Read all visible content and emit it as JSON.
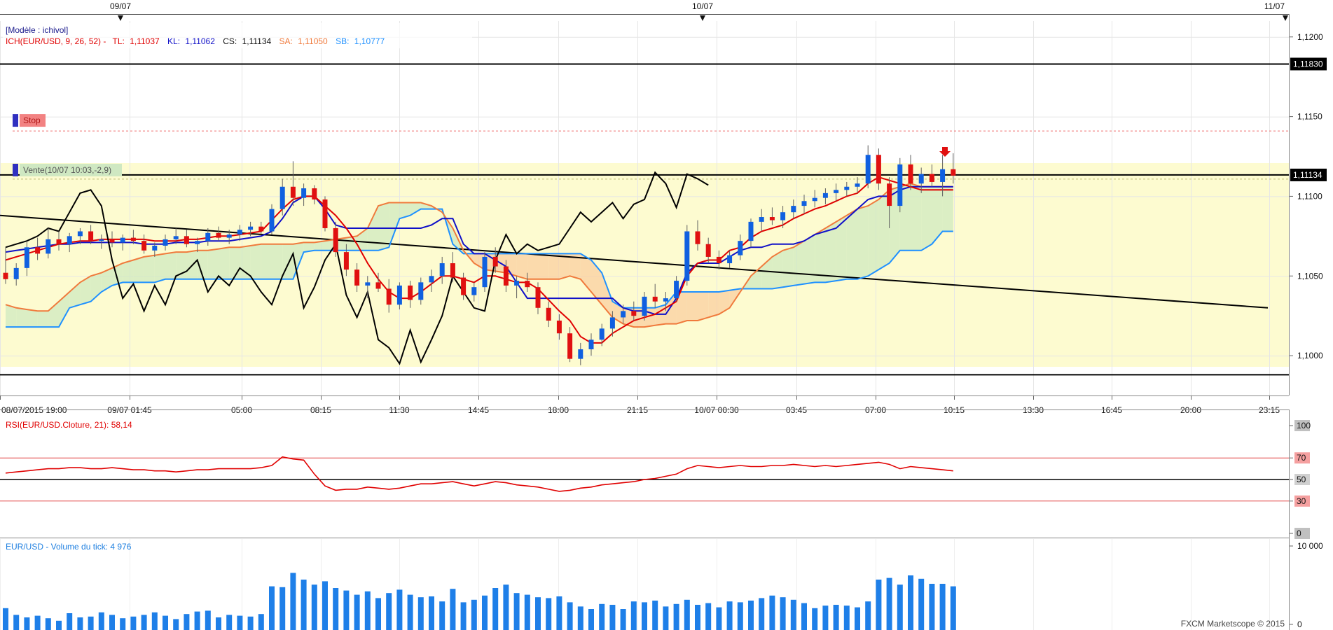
{
  "chart_data": {
    "type": "candlestick",
    "symbol": "EUR/USD",
    "model_label": "[Modèle : ichivol]",
    "date_markers": [
      "09/07",
      "10/07",
      "11/07"
    ],
    "x_tick_labels": [
      "08/07/2015 19:00",
      "09/07 01:45",
      "05:00",
      "08:15",
      "11:30",
      "14:45",
      "18:00",
      "21:15",
      "10/07 00:30",
      "03:45",
      "07:00",
      "10:15",
      "13:30",
      "16:45",
      "20:00",
      "23:15"
    ],
    "price_axis": {
      "ylim": [
        1.0975,
        1.121
      ],
      "ticks": [
        "1,1200",
        "1,1150",
        "1,1100",
        "1,1050",
        "1,1000"
      ]
    },
    "price_flags": [
      {
        "label": "1,11830",
        "value": 1.1183
      },
      {
        "label": "1,11134",
        "value": 1.11134
      }
    ],
    "horizontal_lines": [
      1.1183,
      1.11134,
      1.0988
    ],
    "trendline": {
      "from": 1.1088,
      "to": 1.103
    },
    "orders": [
      {
        "label": "Stop",
        "value": 1.1141
      },
      {
        "label": "Vente(10/07 10:03,-2,9)",
        "value": 1.11134
      }
    ],
    "ichimoku_legend": {
      "prefix": "ICH(EUR/USD, 9, 26, 52) -",
      "tl_label": "TL:",
      "tl_value": "1,11037",
      "kl_label": "KL:",
      "kl_value": "1,11062",
      "cs_label": "CS:",
      "cs_value": "1,11134",
      "sa_label": "SA:",
      "sa_value": "1,11050",
      "sb_label": "SB:",
      "sb_value": "1,10777"
    },
    "candles": [
      [
        1.1052,
        1.1068,
        1.1045,
        1.1048
      ],
      [
        1.1048,
        1.1058,
        1.1044,
        1.1055
      ],
      [
        1.1055,
        1.1072,
        1.105,
        1.1068
      ],
      [
        1.1068,
        1.1074,
        1.106,
        1.1064
      ],
      [
        1.1064,
        1.108,
        1.1061,
        1.1073
      ],
      [
        1.1073,
        1.1078,
        1.1066,
        1.107
      ],
      [
        1.107,
        1.1077,
        1.1065,
        1.1075
      ],
      [
        1.1075,
        1.108,
        1.107,
        1.1078
      ],
      [
        1.1078,
        1.1082,
        1.107,
        1.1072
      ],
      [
        1.1072,
        1.1076,
        1.1067,
        1.1073
      ],
      [
        1.1073,
        1.1078,
        1.1068,
        1.1071
      ],
      [
        1.1071,
        1.1076,
        1.1066,
        1.1074
      ],
      [
        1.1074,
        1.1079,
        1.107,
        1.1072
      ],
      [
        1.1072,
        1.1076,
        1.1064,
        1.1066
      ],
      [
        1.1066,
        1.1071,
        1.1062,
        1.1069
      ],
      [
        1.1069,
        1.1076,
        1.1066,
        1.1073
      ],
      [
        1.1073,
        1.108,
        1.107,
        1.1075
      ],
      [
        1.1075,
        1.1079,
        1.1068,
        1.107
      ],
      [
        1.107,
        1.1074,
        1.1065,
        1.1072
      ],
      [
        1.1072,
        1.108,
        1.1069,
        1.1077
      ],
      [
        1.1077,
        1.1081,
        1.1072,
        1.1074
      ],
      [
        1.1074,
        1.1079,
        1.107,
        1.1076
      ],
      [
        1.1076,
        1.1082,
        1.1072,
        1.1079
      ],
      [
        1.1079,
        1.1084,
        1.1075,
        1.1081
      ],
      [
        1.1081,
        1.1084,
        1.1076,
        1.1078
      ],
      [
        1.1078,
        1.1095,
        1.1076,
        1.1092
      ],
      [
        1.1092,
        1.1111,
        1.1088,
        1.1106
      ],
      [
        1.1106,
        1.1122,
        1.1094,
        1.1099
      ],
      [
        1.1099,
        1.1108,
        1.1094,
        1.1105
      ],
      [
        1.1105,
        1.1107,
        1.1095,
        1.1098
      ],
      [
        1.1098,
        1.11,
        1.1078,
        1.108
      ],
      [
        1.108,
        1.1084,
        1.1062,
        1.1065
      ],
      [
        1.1065,
        1.107,
        1.105,
        1.1054
      ],
      [
        1.1054,
        1.1058,
        1.104,
        1.1044
      ],
      [
        1.1044,
        1.105,
        1.1036,
        1.1046
      ],
      [
        1.1046,
        1.1052,
        1.104,
        1.1042
      ],
      [
        1.1042,
        1.1048,
        1.1027,
        1.1032
      ],
      [
        1.1032,
        1.1046,
        1.1029,
        1.1044
      ],
      [
        1.1044,
        1.1047,
        1.103,
        1.1035
      ],
      [
        1.1035,
        1.1049,
        1.1032,
        1.1046
      ],
      [
        1.1046,
        1.1054,
        1.104,
        1.105
      ],
      [
        1.105,
        1.1062,
        1.1045,
        1.1058
      ],
      [
        1.1058,
        1.1065,
        1.1046,
        1.1049
      ],
      [
        1.1049,
        1.1052,
        1.1035,
        1.1038
      ],
      [
        1.1038,
        1.1046,
        1.1034,
        1.1043
      ],
      [
        1.1043,
        1.1065,
        1.104,
        1.1062
      ],
      [
        1.1062,
        1.1068,
        1.1052,
        1.1056
      ],
      [
        1.1056,
        1.106,
        1.104,
        1.1044
      ],
      [
        1.1044,
        1.105,
        1.1036,
        1.1047
      ],
      [
        1.1047,
        1.1052,
        1.104,
        1.1043
      ],
      [
        1.1043,
        1.1046,
        1.1026,
        1.103
      ],
      [
        1.103,
        1.1034,
        1.1018,
        1.1022
      ],
      [
        1.1022,
        1.1026,
        1.101,
        1.1014
      ],
      [
        1.1014,
        1.1018,
        1.0996,
        1.0998
      ],
      [
        1.0998,
        1.1008,
        1.0994,
        1.1004
      ],
      [
        1.1004,
        1.1014,
        1.1,
        1.101
      ],
      [
        1.101,
        1.102,
        1.1006,
        1.1017
      ],
      [
        1.1017,
        1.1028,
        1.1012,
        1.1024
      ],
      [
        1.1024,
        1.1032,
        1.102,
        1.1028
      ],
      [
        1.1028,
        1.1034,
        1.1022,
        1.1025
      ],
      [
        1.1025,
        1.104,
        1.1022,
        1.1037
      ],
      [
        1.1037,
        1.1045,
        1.103,
        1.1034
      ],
      [
        1.1034,
        1.104,
        1.1028,
        1.1036
      ],
      [
        1.1036,
        1.105,
        1.1034,
        1.1047
      ],
      [
        1.1047,
        1.1082,
        1.1044,
        1.1078
      ],
      [
        1.1078,
        1.1085,
        1.1066,
        1.107
      ],
      [
        1.107,
        1.1074,
        1.1058,
        1.1062
      ],
      [
        1.1062,
        1.1066,
        1.1054,
        1.1058
      ],
      [
        1.1058,
        1.1066,
        1.1055,
        1.1063
      ],
      [
        1.1063,
        1.1076,
        1.106,
        1.1072
      ],
      [
        1.1072,
        1.1086,
        1.1068,
        1.1084
      ],
      [
        1.1084,
        1.1092,
        1.1078,
        1.1087
      ],
      [
        1.1087,
        1.1093,
        1.1082,
        1.1085
      ],
      [
        1.1085,
        1.1094,
        1.108,
        1.109
      ],
      [
        1.109,
        1.1098,
        1.1086,
        1.1094
      ],
      [
        1.1094,
        1.1101,
        1.1089,
        1.1097
      ],
      [
        1.1097,
        1.1104,
        1.1093,
        1.1099
      ],
      [
        1.1099,
        1.1105,
        1.1095,
        1.1102
      ],
      [
        1.1102,
        1.1108,
        1.1097,
        1.1104
      ],
      [
        1.1104,
        1.1109,
        1.11,
        1.1106
      ],
      [
        1.1106,
        1.1112,
        1.1102,
        1.1108
      ],
      [
        1.1108,
        1.1132,
        1.1105,
        1.1126
      ],
      [
        1.1126,
        1.113,
        1.1104,
        1.1108
      ],
      [
        1.1108,
        1.1112,
        1.108,
        1.1094
      ],
      [
        1.1094,
        1.1124,
        1.109,
        1.112
      ],
      [
        1.112,
        1.1126,
        1.1104,
        1.1108
      ],
      [
        1.1108,
        1.1118,
        1.1102,
        1.1114
      ],
      [
        1.1114,
        1.112,
        1.1106,
        1.1109
      ],
      [
        1.1109,
        1.1126,
        1.11,
        1.1117
      ],
      [
        1.1117,
        1.1127,
        1.1108,
        1.1113
      ]
    ],
    "tenkan": [
      1.106,
      1.1062,
      1.1064,
      1.1066,
      1.1068,
      1.107,
      1.1071,
      1.1072,
      1.1072,
      1.1073,
      1.1073,
      1.1073,
      1.1073,
      1.1073,
      1.1072,
      1.1072,
      1.1072,
      1.1073,
      1.1073,
      1.1074,
      1.1075,
      1.1075,
      1.1076,
      1.1077,
      1.1078,
      1.1085,
      1.1092,
      1.1098,
      1.11,
      1.11,
      1.1094,
      1.1088,
      1.108,
      1.107,
      1.1058,
      1.1048,
      1.104,
      1.1036,
      1.1036,
      1.104,
      1.1045,
      1.105,
      1.105,
      1.1048,
      1.1046,
      1.105,
      1.105,
      1.1048,
      1.1046,
      1.1046,
      1.1042,
      1.1035,
      1.1028,
      1.1022,
      1.1012,
      1.1008,
      1.1008,
      1.1014,
      1.1018,
      1.1022,
      1.1024,
      1.1026,
      1.103,
      1.1034,
      1.105,
      1.1058,
      1.106,
      1.106,
      1.1066,
      1.1068,
      1.1074,
      1.1078,
      1.108,
      1.1082,
      1.1086,
      1.1089,
      1.1092,
      1.1094,
      1.1097,
      1.11,
      1.1102,
      1.1108,
      1.1112,
      1.111,
      1.1108,
      1.1106,
      1.1104,
      1.1104,
      1.1104,
      1.1104
    ],
    "kijun": [
      1.1065,
      1.1066,
      1.1067,
      1.1068,
      1.1069,
      1.107,
      1.107,
      1.1071,
      1.1071,
      1.1071,
      1.1071,
      1.1071,
      1.1071,
      1.107,
      1.107,
      1.107,
      1.1071,
      1.1071,
      1.1071,
      1.1072,
      1.1072,
      1.1072,
      1.1073,
      1.1074,
      1.1075,
      1.1078,
      1.1086,
      1.1096,
      1.11,
      1.11,
      1.1092,
      1.1082,
      1.108,
      1.108,
      1.108,
      1.108,
      1.108,
      1.108,
      1.108,
      1.108,
      1.1082,
      1.1086,
      1.1086,
      1.107,
      1.1064,
      1.1064,
      1.106,
      1.1056,
      1.1046,
      1.1036,
      1.1036,
      1.1036,
      1.1036,
      1.1036,
      1.1036,
      1.1036,
      1.1036,
      1.1036,
      1.103,
      1.1028,
      1.1028,
      1.1026,
      1.1026,
      1.1036,
      1.1052,
      1.1058,
      1.1058,
      1.1058,
      1.1062,
      1.1066,
      1.1068,
      1.1068,
      1.107,
      1.107,
      1.107,
      1.1072,
      1.1076,
      1.1078,
      1.108,
      1.1086,
      1.1092,
      1.1098,
      1.11,
      1.11,
      1.1104,
      1.1106,
      1.1106,
      1.1106,
      1.1106,
      1.1106
    ],
    "senkou_a": [
      1.1032,
      1.103,
      1.1029,
      1.1028,
      1.1028,
      1.1034,
      1.104,
      1.1046,
      1.105,
      1.1052,
      1.1055,
      1.1058,
      1.106,
      1.1062,
      1.1063,
      1.1064,
      1.1065,
      1.1065,
      1.1066,
      1.1066,
      1.1067,
      1.1068,
      1.1068,
      1.1069,
      1.107,
      1.107,
      1.107,
      1.107,
      1.1071,
      1.1071,
      1.1072,
      1.1073,
      1.1074,
      1.1075,
      1.108,
      1.1094,
      1.1096,
      1.1096,
      1.1096,
      1.1096,
      1.1094,
      1.109,
      1.108,
      1.1066,
      1.1058,
      1.1054,
      1.1053,
      1.1052,
      1.105,
      1.1048,
      1.1048,
      1.1048,
      1.1048,
      1.105,
      1.1048,
      1.104,
      1.1032,
      1.1024,
      1.102,
      1.1018,
      1.1018,
      1.1019,
      1.102,
      1.102,
      1.1022,
      1.1022,
      1.1024,
      1.1026,
      1.103,
      1.104,
      1.105,
      1.1056,
      1.1062,
      1.1066,
      1.1068,
      1.1072,
      1.1076,
      1.108,
      1.1084,
      1.1088,
      1.1092,
      1.1094,
      1.1098,
      1.1104,
      1.1106,
      1.1108,
      1.1106,
      1.1106,
      1.1106,
      1.1106
    ],
    "senkou_b": [
      1.1018,
      1.1018,
      1.1018,
      1.1018,
      1.1018,
      1.1018,
      1.103,
      1.1032,
      1.1034,
      1.104,
      1.1044,
      1.1046,
      1.1046,
      1.1046,
      1.1046,
      1.1048,
      1.1048,
      1.1048,
      1.1048,
      1.1048,
      1.1048,
      1.1048,
      1.1048,
      1.1048,
      1.1048,
      1.1048,
      1.1048,
      1.1048,
      1.1065,
      1.1066,
      1.1066,
      1.1066,
      1.1066,
      1.1066,
      1.1066,
      1.1066,
      1.1068,
      1.1086,
      1.1088,
      1.1092,
      1.1092,
      1.1092,
      1.107,
      1.1064,
      1.1064,
      1.1064,
      1.1064,
      1.1064,
      1.1064,
      1.1064,
      1.1064,
      1.1064,
      1.1064,
      1.1064,
      1.1064,
      1.106,
      1.1052,
      1.1034,
      1.103,
      1.103,
      1.103,
      1.103,
      1.1032,
      1.104,
      1.104,
      1.104,
      1.104,
      1.104,
      1.1041,
      1.1042,
      1.1042,
      1.1042,
      1.1042,
      1.1043,
      1.1044,
      1.1045,
      1.1046,
      1.1046,
      1.1047,
      1.1048,
      1.1048,
      1.105,
      1.1054,
      1.1058,
      1.1066,
      1.1066,
      1.1066,
      1.107,
      1.1078,
      1.1078
    ],
    "chikou": [
      1.1068,
      1.107,
      1.1072,
      1.1075,
      1.108,
      1.1078,
      1.109,
      1.1102,
      1.1104,
      1.1094,
      1.106,
      1.1036,
      1.1045,
      1.1028,
      1.1044,
      1.1032,
      1.105,
      1.1053,
      1.106,
      1.104,
      1.105,
      1.1044,
      1.1055,
      1.105,
      1.104,
      1.1032,
      1.105,
      1.1064,
      1.103,
      1.1043,
      1.106,
      1.107,
      1.1038,
      1.1024,
      1.104,
      1.101,
      1.1005,
      1.0995,
      1.1016,
      1.0996,
      1.101,
      1.1025,
      1.105,
      1.104,
      1.103,
      1.1028,
      1.106,
      1.1076,
      1.1064,
      1.107,
      1.1066,
      1.1068,
      1.107,
      1.108,
      1.109,
      1.1084,
      1.109,
      1.1096,
      1.1086,
      1.1095,
      1.1098,
      1.1115,
      1.1108,
      1.1093,
      1.1114,
      1.1111,
      1.1107
    ],
    "rsi": {
      "legend": "RSI(EUR/USD.Cloture, 21): 58,14",
      "ylim": [
        0,
        100
      ],
      "levels": [
        {
          "label": "100",
          "value": 100
        },
        {
          "label": "70",
          "value": 70
        },
        {
          "label": "50",
          "value": 50
        },
        {
          "label": "30",
          "value": 30
        },
        {
          "label": "0",
          "value": 0
        }
      ],
      "values": [
        56,
        57,
        58,
        59,
        60,
        60,
        61,
        61,
        60,
        60,
        61,
        60,
        59,
        59,
        58,
        58,
        57,
        58,
        59,
        59,
        60,
        60,
        60,
        60,
        61,
        63,
        71,
        69,
        68,
        55,
        44,
        40,
        41,
        41,
        43,
        42,
        41,
        42,
        44,
        46,
        46,
        47,
        48,
        46,
        44,
        46,
        48,
        47,
        45,
        44,
        43,
        41,
        39,
        40,
        42,
        43,
        45,
        46,
        47,
        48,
        50,
        51,
        53,
        55,
        60,
        63,
        62,
        61,
        62,
        63,
        62,
        62,
        63,
        63,
        64,
        63,
        62,
        63,
        62,
        63,
        64,
        65,
        66,
        64,
        60,
        62,
        61,
        60,
        59,
        58
      ]
    },
    "volume": {
      "legend": "EUR/USD - Volume du tick: 4 976",
      "ylim": [
        0,
        10000
      ],
      "ticks": [
        {
          "label": "10 000",
          "value": 10000
        },
        {
          "label": "0",
          "value": 0
        }
      ],
      "values": [
        2600,
        1800,
        1500,
        1700,
        1400,
        1100,
        2000,
        1500,
        1600,
        2100,
        1800,
        1400,
        1600,
        1800,
        2100,
        1700,
        1300,
        1900,
        2200,
        2300,
        1500,
        1800,
        1700,
        1600,
        1900,
        5200,
        5100,
        6800,
        6000,
        5400,
        5800,
        5000,
        4700,
        4200,
        4600,
        3800,
        4400,
        4800,
        4200,
        3900,
        4000,
        3400,
        4900,
        3300,
        3600,
        4100,
        5000,
        5400,
        4400,
        4200,
        3900,
        3800,
        4000,
        3300,
        2800,
        2500,
        3100,
        3000,
        2500,
        3400,
        3300,
        3500,
        2800,
        3100,
        3600,
        3000,
        3200,
        2700,
        3400,
        3300,
        3500,
        3800,
        4100,
        3900,
        3600,
        3200,
        2600,
        2900,
        3000,
        2900,
        2700,
        3400,
        6000,
        6200,
        5400,
        6500,
        6100,
        5500,
        5500,
        5200
      ]
    },
    "footer": "FXCM Marketscope © 2015"
  }
}
